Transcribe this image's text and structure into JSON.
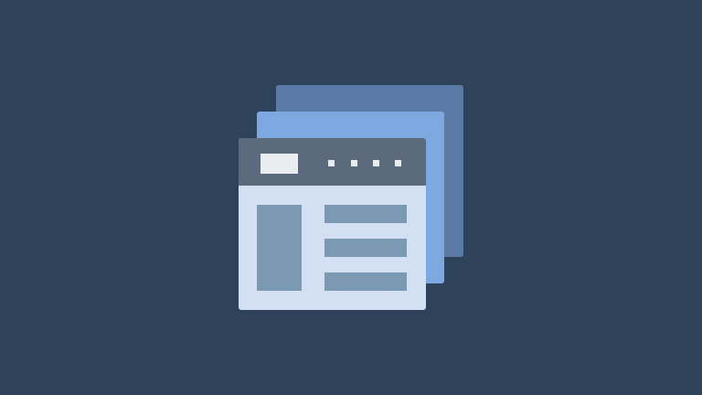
{
  "illustration": {
    "name": "stacked-browser-windows-icon",
    "colors": {
      "background": "#2e4359",
      "back_window": "#5c7aa6",
      "middle_window": "#7ea8e0",
      "front_window": "#d3e0f3",
      "titlebar": "#5c6a7e",
      "titlebar_elements": "#e9edf0",
      "content_blocks": "#7c99b3"
    }
  }
}
